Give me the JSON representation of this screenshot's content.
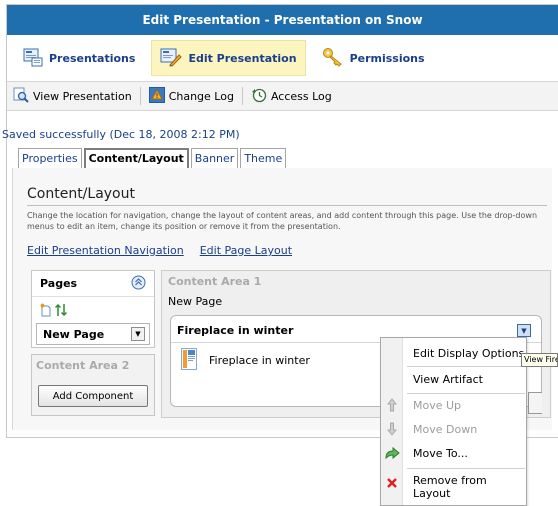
{
  "window": {
    "title": "Edit Presentation - Presentation on Snow"
  },
  "nav": {
    "items": [
      {
        "label": "Presentations",
        "icon": "presentations-icon"
      },
      {
        "label": "Edit Presentation",
        "icon": "edit-presentation-icon",
        "active": true
      },
      {
        "label": "Permissions",
        "icon": "key-icon"
      }
    ]
  },
  "toolbar": {
    "view_presentation": "View Presentation",
    "change_log": "Change Log",
    "access_log": "Access Log"
  },
  "status": "Saved successfully (Dec 18, 2008 2:12 PM)",
  "tabs": [
    "Properties",
    "Content/Layout",
    "Banner",
    "Theme"
  ],
  "section": {
    "title": "Content/Layout",
    "description": "Change the location for navigation, change the layout of content areas, and add content through this page. Use the drop-down menus to edit an item, change its position or remove it from the presentation.",
    "link_nav": "Edit Presentation Navigation",
    "link_layout": "Edit Page Layout"
  },
  "pages": {
    "title": "Pages",
    "selected": "New Page"
  },
  "content_area_2": {
    "title": "Content Area 2",
    "add_button": "Add Component"
  },
  "content_area_1": {
    "title": "Content Area 1",
    "subtitle": "New Page",
    "card_title": "Fireplace in winter",
    "artifact": "Fireplace in winter"
  },
  "menu": {
    "edit_display_options": "Edit Display Options",
    "view_artifact": "View Artifact",
    "move_up": "Move Up",
    "move_down": "Move Down",
    "move_to": "Move To...",
    "remove": "Remove from Layout"
  },
  "tooltip": "View Fireplace in winter",
  "colors": {
    "title_bar": "#1f6fae",
    "link": "#1a3f8a",
    "active_nav": "#fdf5c0"
  }
}
